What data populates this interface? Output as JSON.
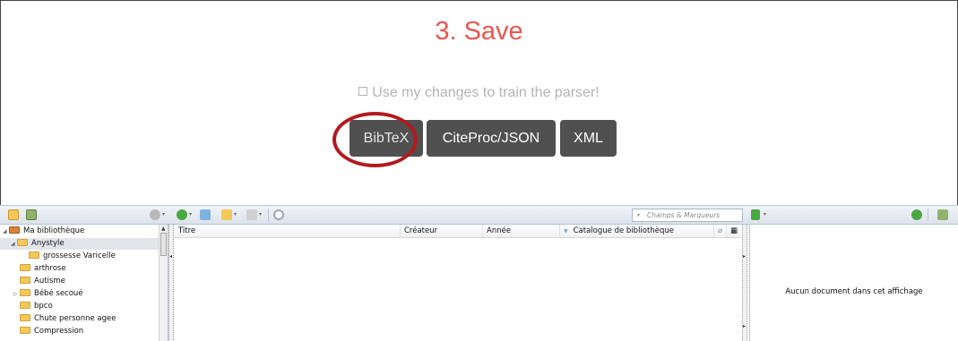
{
  "web": {
    "title": "3. Save",
    "train_label": "Use my changes to train the parser!",
    "buttons": {
      "bibtex": "BibTeX",
      "csl": "CiteProc/JSON",
      "xml": "XML"
    },
    "colors": {
      "title": "#e8564f",
      "button": "#505050",
      "highlight_circle": "#b3191e"
    }
  },
  "zotero": {
    "search_placeholder": "Champs & Marqueurs",
    "collections": [
      {
        "label": "Ma bibliothèque",
        "icon": "library-icon",
        "twisty": "◢"
      },
      {
        "label": "Anystyle",
        "icon": "folder-icon",
        "twisty": "◢"
      },
      {
        "label": "grossesse Varicelle",
        "icon": "folder-icon",
        "twisty": ""
      },
      {
        "label": "arthrose",
        "icon": "folder-icon",
        "twisty": ""
      },
      {
        "label": "Autisme",
        "icon": "folder-icon",
        "twisty": ""
      },
      {
        "label": "Bébé secoué",
        "icon": "folder-icon",
        "twisty": "▷"
      },
      {
        "label": "bpco",
        "icon": "folder-icon",
        "twisty": ""
      },
      {
        "label": "Chute personne agee",
        "icon": "folder-icon",
        "twisty": ""
      },
      {
        "label": "Compression",
        "icon": "folder-icon",
        "twisty": ""
      }
    ],
    "columns": {
      "title": "Titre",
      "creator": "Créateur",
      "year": "Année",
      "catalog": "Catalogue de bibliothèque"
    },
    "empty_message": "Aucun document dans cet affichage"
  }
}
